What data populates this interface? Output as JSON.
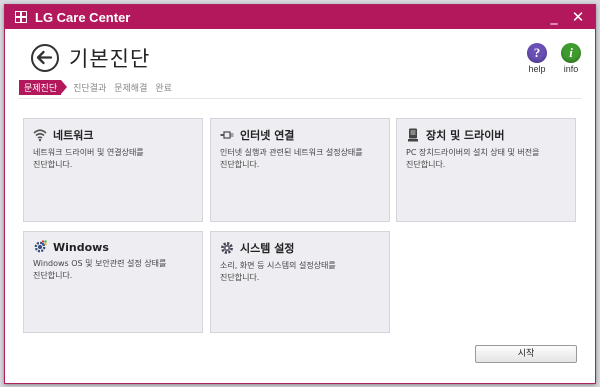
{
  "window": {
    "title": "LG Care Center",
    "minimize": "_",
    "close": "✕"
  },
  "header": {
    "title": "기본진단",
    "help_label": "help",
    "info_label": "info",
    "help_glyph": "?",
    "info_glyph": "i"
  },
  "steps": [
    {
      "label": "문제진단",
      "active": true
    },
    {
      "label": "진단결과",
      "active": false
    },
    {
      "label": "문제해결",
      "active": false
    },
    {
      "label": "완료",
      "active": false
    }
  ],
  "cards": [
    {
      "icon": "wifi-icon",
      "title": "네트워크",
      "desc": [
        "네트워크 드라이버 및 연결상태를",
        "진단합니다."
      ]
    },
    {
      "icon": "ethernet-icon",
      "title": "인터넷 연결",
      "desc": [
        "인터넷 실행과 관련된 네트워크 설정상태를",
        "진단합니다."
      ]
    },
    {
      "icon": "device-icon",
      "title": "장치 및 드라이버",
      "desc": [
        "PC 장치드라이버의 설치 상태 및 버전을",
        "진단합니다."
      ]
    },
    {
      "icon": "windows-gear-icon",
      "title": "Windows",
      "desc": [
        "Windows OS 및 보안관련 설정 상태를",
        "진단합니다."
      ]
    },
    {
      "icon": "gear-icon",
      "title": "시스템 설정",
      "desc": [
        "소리, 화면 등 시스템의 설정상태를",
        "진단합니다."
      ]
    }
  ],
  "start_button": "시작",
  "colors": {
    "accent": "#b3185c",
    "card_bg": "#eeeef2"
  }
}
